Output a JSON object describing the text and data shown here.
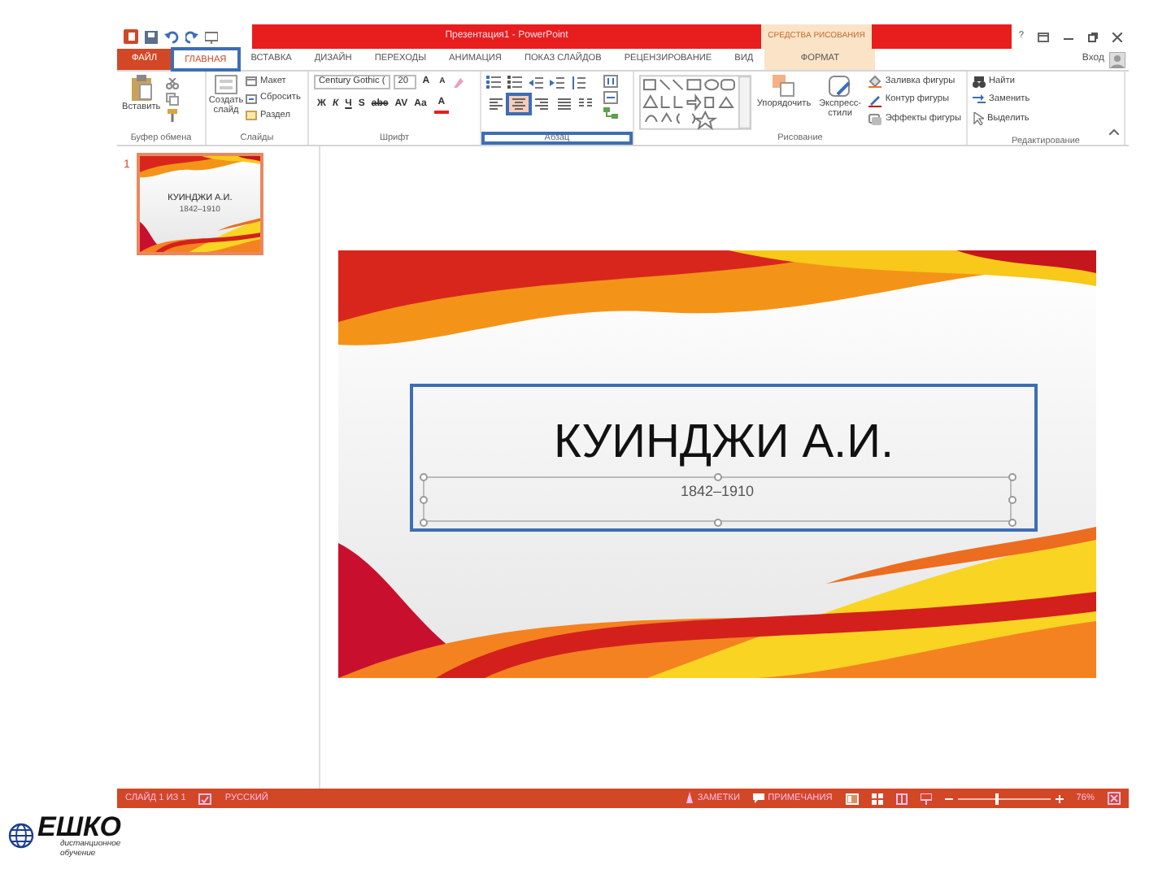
{
  "window": {
    "title": "Презентация1 - PowerPoint",
    "context_group": "СРЕДСТВА РИСОВАНИЯ",
    "help": "?",
    "account": "Вход"
  },
  "tabs": [
    {
      "label": "ФАЙЛ",
      "kind": "file",
      "selected": false,
      "highlighted": false
    },
    {
      "label": "ГЛАВНАЯ",
      "kind": "normal",
      "selected": true,
      "highlighted": true
    },
    {
      "label": "ВСТАВКА",
      "kind": "normal",
      "selected": false,
      "highlighted": false
    },
    {
      "label": "ДИЗАЙН",
      "kind": "normal",
      "selected": false,
      "highlighted": false
    },
    {
      "label": "ПЕРЕХОДЫ",
      "kind": "normal",
      "selected": false,
      "highlighted": false
    },
    {
      "label": "АНИМАЦИЯ",
      "kind": "normal",
      "selected": false,
      "highlighted": false
    },
    {
      "label": "ПОКАЗ СЛАЙДОВ",
      "kind": "normal",
      "selected": false,
      "highlighted": false
    },
    {
      "label": "РЕЦЕНЗИРОВАНИЕ",
      "kind": "normal",
      "selected": false,
      "highlighted": false
    },
    {
      "label": "ВИД",
      "kind": "normal",
      "selected": false,
      "highlighted": false
    },
    {
      "label": "ФОРМАТ",
      "kind": "contextual",
      "selected": false,
      "highlighted": false
    }
  ],
  "ribbon": {
    "clipboard": {
      "label": "Буфер обмена",
      "paste": "Вставить"
    },
    "slides": {
      "label": "Слайды",
      "new_slide": "Создать слайд",
      "layout": "Макет",
      "reset": "Сбросить",
      "section": "Раздел"
    },
    "font": {
      "label": "Шрифт",
      "font_name": "Century Gothic (",
      "font_size": "20",
      "grow": "A",
      "shrink": "A",
      "format_buttons": [
        "Ж",
        "К",
        "Ч",
        "S",
        "abc",
        "AV",
        "Aa"
      ],
      "color_button": "A"
    },
    "paragraph": {
      "label": "Абзац",
      "highlighted": true,
      "align_buttons": [
        {
          "kind": "left",
          "selected": false,
          "highlighted": false
        },
        {
          "kind": "center",
          "selected": true,
          "highlighted": true
        },
        {
          "kind": "right",
          "selected": false,
          "highlighted": false
        },
        {
          "kind": "justify",
          "selected": false,
          "highlighted": false
        }
      ]
    },
    "drawing": {
      "label": "Рисование",
      "arrange": "Упорядочить",
      "quick_styles": "Экспресс-стили",
      "fill": "Заливка фигуры",
      "outline": "Контур фигуры",
      "effects": "Эффекты фигуры"
    },
    "editing": {
      "label": "Редактирование",
      "find": "Найти",
      "replace": "Заменить",
      "select": "Выделить"
    }
  },
  "thumbnails": [
    {
      "number": "1",
      "title": "КУИНДЖИ А.И.",
      "subtitle": "1842–1910",
      "selected": true
    }
  ],
  "slide": {
    "title": "КУИНДЖИ А.И.",
    "subtitle": "1842–1910",
    "title_highlighted": true,
    "subtitle_selected": true
  },
  "status_bar": {
    "slide_info": "СЛАЙД 1 ИЗ 1",
    "language": "РУССКИЙ",
    "notes": "ЗАМЕТКИ",
    "comments": "ПРИМЕЧАНИЯ",
    "zoom": {
      "level": 0.4,
      "reading": "76%"
    }
  },
  "logo": {
    "name": "ЕШКО",
    "tagline": "дистанционное обучение"
  }
}
